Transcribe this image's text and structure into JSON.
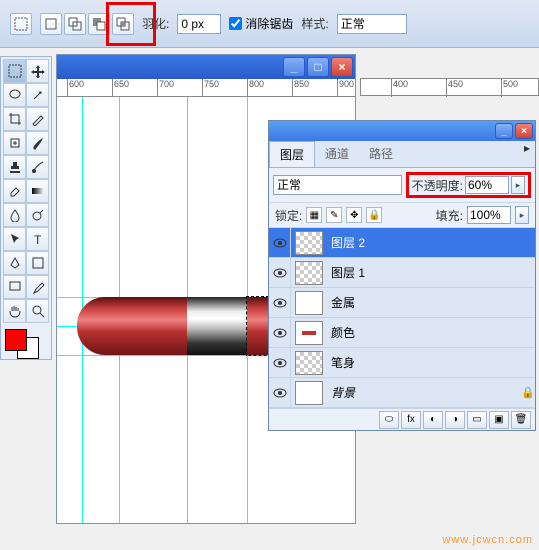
{
  "options": {
    "feather_label": "羽化:",
    "feather_value": "0 px",
    "antialias_label": "消除锯齿",
    "style_label": "样式:",
    "style_value": "正常"
  },
  "ruler_ticks": [
    "600",
    "650",
    "700",
    "750",
    "800",
    "850",
    "900"
  ],
  "ruler2_ticks": [
    "400",
    "450",
    "500"
  ],
  "panel": {
    "tabs": {
      "layers": "图层",
      "channels": "通道",
      "paths": "路径"
    },
    "blend_mode": "正常",
    "opacity_label": "不透明度:",
    "opacity_value": "60%",
    "lock_label": "锁定:",
    "fill_label": "填充:",
    "fill_value": "100%"
  },
  "layers": [
    {
      "name": "图层 2",
      "sel": true,
      "thumb": "checker"
    },
    {
      "name": "图层 1",
      "sel": false,
      "thumb": "checker"
    },
    {
      "name": "金属",
      "sel": false,
      "thumb": "solid"
    },
    {
      "name": "颜色",
      "sel": false,
      "thumb": "red"
    },
    {
      "name": "笔身",
      "sel": false,
      "thumb": "checker"
    },
    {
      "name": "背景",
      "sel": false,
      "thumb": "solid",
      "locked": true,
      "italic": true
    }
  ],
  "watermark": "www.jcwcn.com"
}
